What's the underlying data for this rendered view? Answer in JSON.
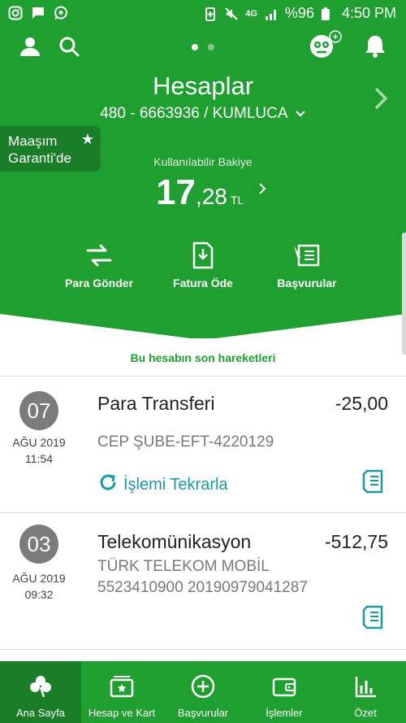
{
  "status_bar": {
    "battery_percent": "%96",
    "time": "4:50 PM",
    "network": "4G",
    "left_icons": [
      "instagram-icon",
      "message-icon",
      "whatsapp-icon"
    ],
    "right_icons": [
      "battery-saver-icon",
      "mute-icon",
      "signal-icon",
      "battery-icon"
    ]
  },
  "header": {
    "title": "Hesaplar",
    "account": "480 - 6663936 / KUMLUCA",
    "page_indicator": {
      "count": 2,
      "active": 1
    },
    "salary_badge": {
      "line1": "Maaşım",
      "line2": "Garanti'de"
    }
  },
  "balance": {
    "label": "Kullanılabilir Bakiye",
    "integer": "17",
    "decimal": ",28",
    "currency": "TL"
  },
  "actions": [
    {
      "label": "Para Gönder",
      "icon": "transfer-icon"
    },
    {
      "label": "Fatura Öde",
      "icon": "bill-icon"
    },
    {
      "label": "Başvurular",
      "icon": "application-icon"
    }
  ],
  "recent_title": "Bu hesabın son hareketleri",
  "transactions": [
    {
      "day": "07",
      "month_year": "AĞU 2019",
      "time": "11:54",
      "title": "Para Transferi",
      "amount": "-25,00",
      "description": "CEP ŞUBE-EFT-4220129",
      "repeat_label": "İşlemi Tekrarla"
    },
    {
      "day": "03",
      "month_year": "AĞU 2019",
      "time": "09:32",
      "title": "Telekomünikasyon",
      "amount": "-512,75",
      "description_line1": "TÜRK TELEKOM MOBİL",
      "description_line2": "5523410900 20190979041287"
    }
  ],
  "bottom_nav": [
    {
      "label": "Ana Sayfa",
      "icon": "home-clover-icon",
      "active": true
    },
    {
      "label": "Hesap ve Kart",
      "icon": "card-icon",
      "active": false
    },
    {
      "label": "Başvurular",
      "icon": "plus-circle-icon",
      "active": false
    },
    {
      "label": "İşlemler",
      "icon": "wallet-icon",
      "active": false
    },
    {
      "label": "Özet",
      "icon": "bar-chart-icon",
      "active": false
    }
  ],
  "colors": {
    "primary": "#1f9f2f",
    "primary_dark": "#1a7d27",
    "link": "#1b9aa3",
    "badge": "#7b7b7b"
  }
}
